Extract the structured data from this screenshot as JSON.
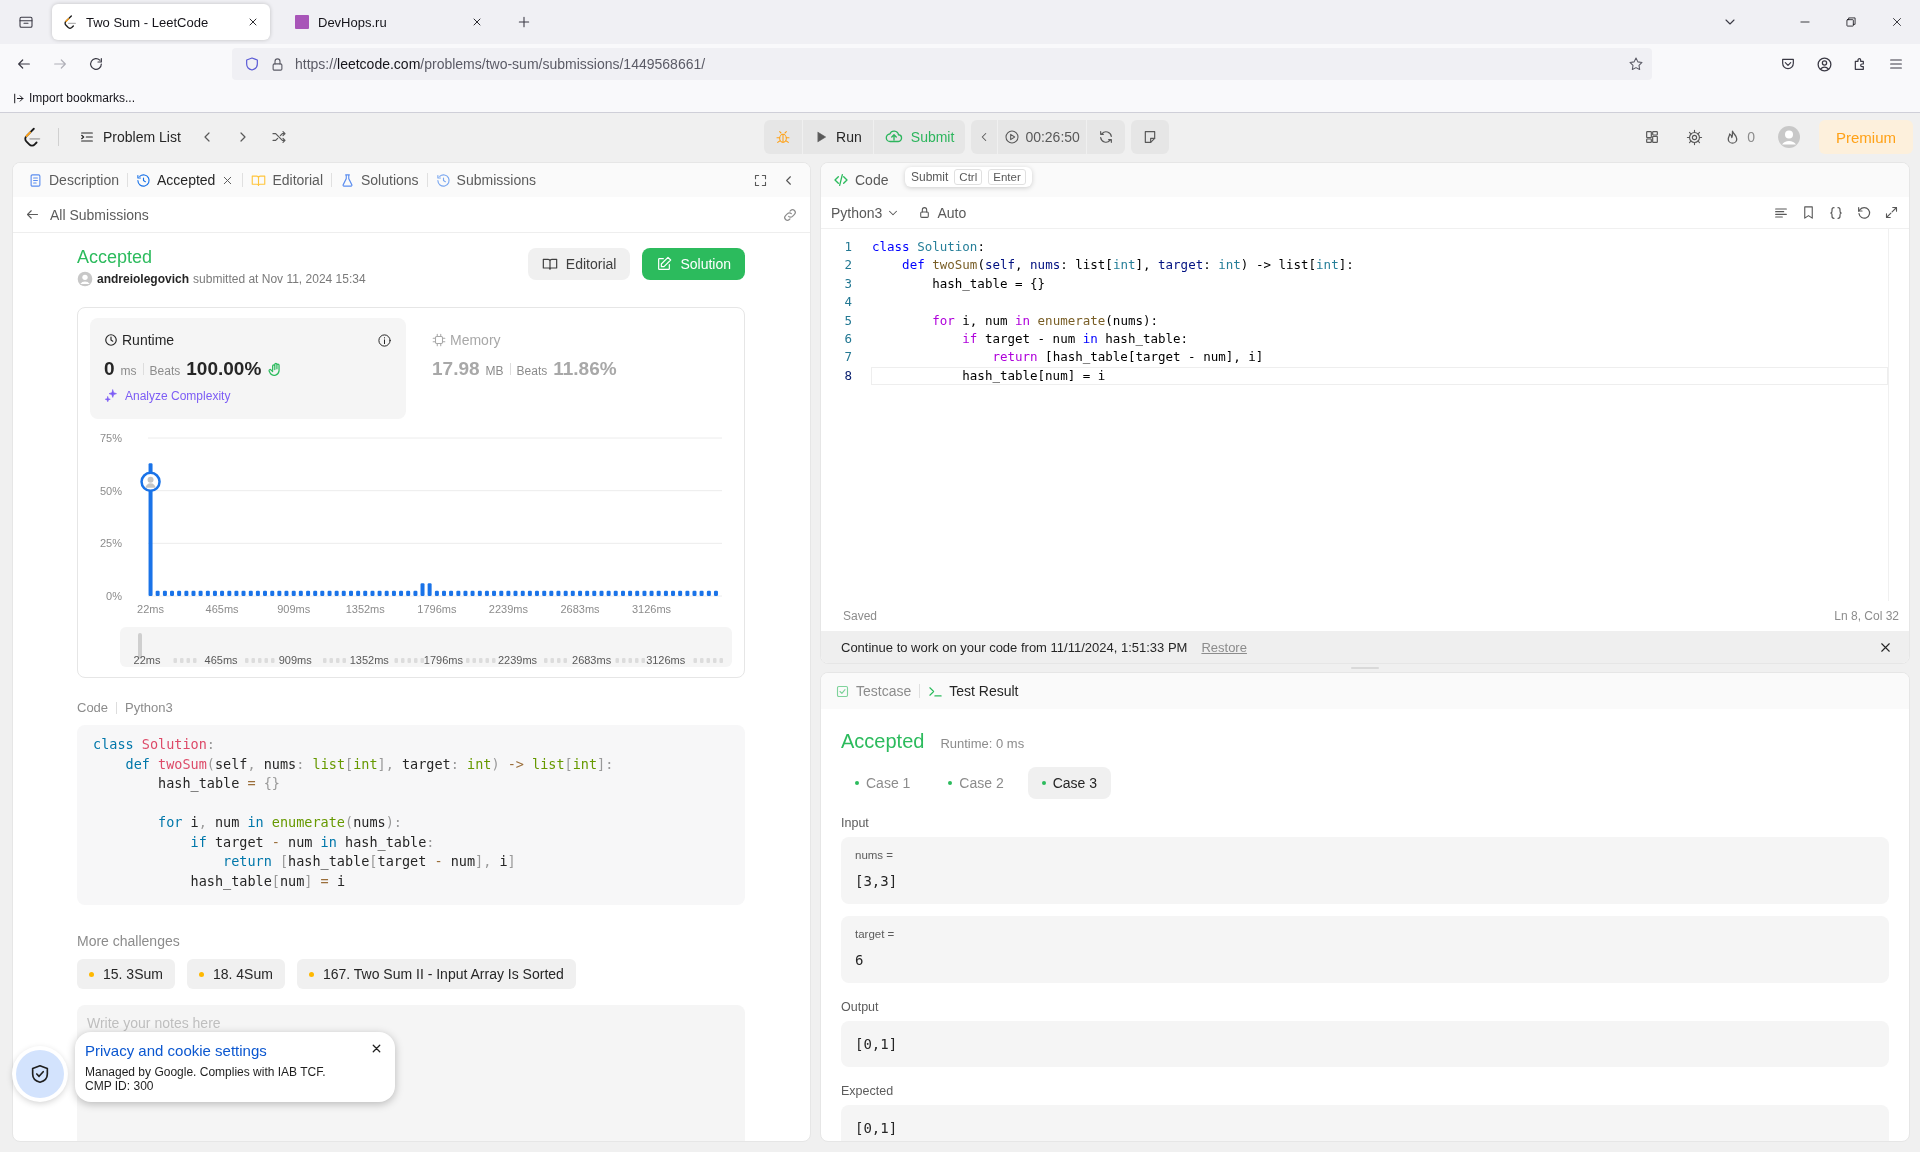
{
  "browser": {
    "tabs": [
      {
        "title": "Two Sum - LeetCode",
        "selected": true
      },
      {
        "title": "DevHops.ru",
        "selected": false
      }
    ],
    "url": {
      "prefix": "https://",
      "host": "leetcode.com",
      "path": "/problems/two-sum/submissions/1449568661/"
    },
    "bookmarks": [
      "Import bookmarks..."
    ]
  },
  "header": {
    "problem_list": "Problem List",
    "run": "Run",
    "submit": "Submit",
    "timer": "00:26:50",
    "streak": "0",
    "premium": "Premium"
  },
  "left_panel": {
    "tabs": [
      {
        "label": "Description",
        "selected": false,
        "closable": false
      },
      {
        "label": "Accepted",
        "selected": true,
        "closable": true
      },
      {
        "label": "Editorial",
        "selected": false,
        "closable": false
      },
      {
        "label": "Solutions",
        "selected": false,
        "closable": false
      },
      {
        "label": "Submissions",
        "selected": false,
        "closable": false
      }
    ],
    "back_link": "All Submissions",
    "status": "Accepted",
    "user": "andreiolegovich",
    "submitted": "submitted at Nov 11, 2024 15:34",
    "buttons": [
      {
        "label": "Editorial",
        "kind": "secondary"
      },
      {
        "label": "Solution",
        "kind": "primary"
      }
    ],
    "metrics": [
      {
        "title": "Runtime",
        "value": "0",
        "unit": "ms",
        "beats_label": "Beats",
        "beats": "100.00%",
        "selected": true,
        "link": "Analyze Complexity"
      },
      {
        "title": "Memory",
        "value": "17.98",
        "unit": "MB",
        "beats_label": "Beats",
        "beats": "11.86%",
        "selected": false
      }
    ],
    "chart_data": {
      "type": "bar",
      "xlim": [
        0,
        3550
      ],
      "ylim": [
        0,
        75
      ],
      "x": [
        22,
        66,
        111,
        155,
        199,
        244,
        288,
        332,
        377,
        421,
        465,
        510,
        554,
        598,
        643,
        687,
        731,
        776,
        820,
        864,
        909,
        953,
        998,
        1042,
        1086,
        1131,
        1175,
        1219,
        1264,
        1308,
        1352,
        1397,
        1441,
        1485,
        1530,
        1574,
        1618,
        1663,
        1707,
        1751,
        1796,
        1840,
        1884,
        1929,
        1973,
        2017,
        2062,
        2106,
        2150,
        2195,
        2239,
        2283,
        2328,
        2372,
        2416,
        2461,
        2505,
        2549,
        2594,
        2638,
        2683,
        2727,
        2771,
        2816,
        2860,
        2904,
        2949,
        2993,
        3037,
        3082,
        3126,
        3170,
        3215,
        3259,
        3303,
        3348,
        3392,
        3436,
        3481,
        3525
      ],
      "values": [
        63,
        2.5,
        2.5,
        2.5,
        2.5,
        2.5,
        2.5,
        2.5,
        2.5,
        2.5,
        2.5,
        2.5,
        2.5,
        2.5,
        2.5,
        2.5,
        2.5,
        2.5,
        2.5,
        2.5,
        2.5,
        2.5,
        2.5,
        2.5,
        2.5,
        2.5,
        2.5,
        2.5,
        2.5,
        2.5,
        2.5,
        2.5,
        2.5,
        2.5,
        2.5,
        2.5,
        2.5,
        2.5,
        6,
        6,
        2.5,
        2.5,
        2.5,
        2.5,
        2.5,
        2.5,
        2.5,
        2.5,
        2.5,
        2.5,
        2.5,
        2.5,
        2.5,
        2.5,
        2.5,
        2.5,
        2.5,
        2.5,
        2.5,
        2.5,
        2.5,
        2.5,
        2.5,
        2.5,
        2.5,
        2.5,
        2.5,
        2.5,
        2.5,
        2.5,
        2.5,
        2.5,
        2.5,
        2.5,
        2.5,
        2.5,
        2.5,
        2.5,
        2.5,
        2.5
      ],
      "xticks": [
        {
          "value": 22,
          "label": "22ms"
        },
        {
          "value": 465,
          "label": "465ms"
        },
        {
          "value": 909,
          "label": "909ms"
        },
        {
          "value": 1352,
          "label": "1352ms"
        },
        {
          "value": 1796,
          "label": "1796ms"
        },
        {
          "value": 2239,
          "label": "2239ms"
        },
        {
          "value": 2683,
          "label": "2683ms"
        },
        {
          "value": 3126,
          "label": "3126ms"
        }
      ],
      "yticks": [
        {
          "value": 0,
          "label": "0%"
        },
        {
          "value": 25,
          "label": "25%"
        },
        {
          "value": 50,
          "label": "50%"
        },
        {
          "value": 75,
          "label": "75%"
        }
      ]
    },
    "range_slider": {
      "level": 0,
      "labels": [
        "22ms",
        "465ms",
        "909ms",
        "1352ms",
        "1796ms",
        "2239ms",
        "2683ms",
        "3126ms"
      ]
    },
    "code_label": "Code",
    "language": "Python3",
    "code": [
      {
        "kind": "code",
        "tokens": [
          {
            "kind": "keyword",
            "text": "class "
          },
          {
            "kind": "type",
            "text": "Solution"
          },
          {
            "kind": "punct",
            "text": ":"
          }
        ]
      },
      {
        "kind": "code",
        "tokens": [
          {
            "kind": "keyword",
            "text": "    def "
          },
          {
            "kind": "function",
            "text": "twoSum"
          },
          {
            "kind": "punct",
            "text": "("
          },
          {
            "kind": "plain",
            "text": "self"
          },
          {
            "kind": "punct",
            "text": ", "
          },
          {
            "kind": "plain",
            "text": "nums"
          },
          {
            "kind": "punct",
            "text": ": "
          },
          {
            "kind": "builtin",
            "text": "list"
          },
          {
            "kind": "punct",
            "text": "["
          },
          {
            "kind": "builtin",
            "text": "int"
          },
          {
            "kind": "punct",
            "text": "], "
          },
          {
            "kind": "plain",
            "text": "target"
          },
          {
            "kind": "punct",
            "text": ": "
          },
          {
            "kind": "builtin",
            "text": "int"
          },
          {
            "kind": "punct",
            "text": ") "
          },
          {
            "kind": "operator",
            "text": "-> "
          },
          {
            "kind": "builtin",
            "text": "list"
          },
          {
            "kind": "punct",
            "text": "["
          },
          {
            "kind": "builtin",
            "text": "int"
          },
          {
            "kind": "punct",
            "text": "]:"
          }
        ]
      },
      {
        "kind": "code",
        "tokens": [
          {
            "kind": "plain",
            "text": "        hash_table "
          },
          {
            "kind": "operator",
            "text": "= "
          },
          {
            "kind": "punct",
            "text": "{}"
          }
        ]
      },
      {
        "kind": "blank"
      },
      {
        "kind": "code",
        "tokens": [
          {
            "kind": "keyword",
            "text": "        for"
          },
          {
            "kind": "plain",
            "text": " i"
          },
          {
            "kind": "punct",
            "text": ", "
          },
          {
            "kind": "plain",
            "text": "num "
          },
          {
            "kind": "keyword",
            "text": "in "
          },
          {
            "kind": "builtin",
            "text": "enumerate"
          },
          {
            "kind": "punct",
            "text": "("
          },
          {
            "kind": "plain",
            "text": "nums"
          },
          {
            "kind": "punct",
            "text": "):"
          }
        ]
      },
      {
        "kind": "code",
        "tokens": [
          {
            "kind": "keyword",
            "text": "            if"
          },
          {
            "kind": "plain",
            "text": " target "
          },
          {
            "kind": "operator",
            "text": "-"
          },
          {
            "kind": "plain",
            "text": " num "
          },
          {
            "kind": "keyword",
            "text": "in"
          },
          {
            "kind": "plain",
            "text": " hash_table"
          },
          {
            "kind": "punct",
            "text": ":"
          }
        ]
      },
      {
        "kind": "code",
        "tokens": [
          {
            "kind": "keyword",
            "text": "                return "
          },
          {
            "kind": "punct",
            "text": "["
          },
          {
            "kind": "plain",
            "text": "hash_table"
          },
          {
            "kind": "punct",
            "text": "["
          },
          {
            "kind": "plain",
            "text": "target "
          },
          {
            "kind": "operator",
            "text": "-"
          },
          {
            "kind": "plain",
            "text": " num"
          },
          {
            "kind": "punct",
            "text": "], "
          },
          {
            "kind": "plain",
            "text": "i"
          },
          {
            "kind": "punct",
            "text": "]"
          }
        ]
      },
      {
        "kind": "code",
        "tokens": [
          {
            "kind": "plain",
            "text": "            hash_table"
          },
          {
            "kind": "punct",
            "text": "["
          },
          {
            "kind": "plain",
            "text": "num"
          },
          {
            "kind": "punct",
            "text": "] "
          },
          {
            "kind": "operator",
            "text": "="
          },
          {
            "kind": "plain",
            "text": " i"
          }
        ]
      }
    ],
    "more_challenges": {
      "title": "More challenges",
      "items": [
        "15. 3Sum",
        "18. 4Sum",
        "167. Two Sum II - Input Array Is Sorted"
      ]
    },
    "notes": {
      "placeholder": "Write your notes here"
    }
  },
  "editor": {
    "tab": "Code",
    "tooltip": {
      "label": "Submit",
      "keys": [
        "Ctrl",
        "Enter"
      ]
    },
    "language": "Python3",
    "mode": "Auto",
    "lines": [
      {
        "kind": "code",
        "number": "1",
        "current": false,
        "tokens": [
          {
            "kind": "keyword",
            "text": "class "
          },
          {
            "kind": "type",
            "text": "Solution"
          },
          {
            "kind": "plain",
            "text": ":"
          }
        ]
      },
      {
        "kind": "code",
        "number": "2",
        "current": false,
        "tokens": [
          {
            "kind": "keyword",
            "text": "    def "
          },
          {
            "kind": "function",
            "text": "twoSum"
          },
          {
            "kind": "plain",
            "text": "("
          },
          {
            "kind": "param",
            "text": "self"
          },
          {
            "kind": "plain",
            "text": ", "
          },
          {
            "kind": "param",
            "text": "nums"
          },
          {
            "kind": "plain",
            "text": ": list["
          },
          {
            "kind": "type",
            "text": "int"
          },
          {
            "kind": "plain",
            "text": "], "
          },
          {
            "kind": "param",
            "text": "target"
          },
          {
            "kind": "plain",
            "text": ": "
          },
          {
            "kind": "type",
            "text": "int"
          },
          {
            "kind": "plain",
            "text": ") -> list["
          },
          {
            "kind": "type",
            "text": "int"
          },
          {
            "kind": "plain",
            "text": "]:"
          }
        ]
      },
      {
        "kind": "code",
        "number": "3",
        "current": false,
        "tokens": [
          {
            "kind": "plain",
            "text": "        hash_table = {}"
          }
        ]
      },
      {
        "kind": "blank",
        "number": "4",
        "current": false
      },
      {
        "kind": "code",
        "number": "5",
        "current": false,
        "tokens": [
          {
            "kind": "control",
            "text": "        for"
          },
          {
            "kind": "plain",
            "text": " i, num "
          },
          {
            "kind": "control",
            "text": "in "
          },
          {
            "kind": "function",
            "text": "enumerate"
          },
          {
            "kind": "plain",
            "text": "(nums):"
          }
        ]
      },
      {
        "kind": "code",
        "number": "6",
        "current": false,
        "tokens": [
          {
            "kind": "control",
            "text": "            if"
          },
          {
            "kind": "plain",
            "text": " target - num "
          },
          {
            "kind": "keyword",
            "text": "in"
          },
          {
            "kind": "plain",
            "text": " hash_table:"
          }
        ]
      },
      {
        "kind": "code",
        "number": "7",
        "current": false,
        "tokens": [
          {
            "kind": "control",
            "text": "                return"
          },
          {
            "kind": "plain",
            "text": " [hash_table[target - num], i]"
          }
        ]
      },
      {
        "kind": "code",
        "number": "8",
        "current": true,
        "tokens": [
          {
            "kind": "plain",
            "text": "            hash_table[num] = i"
          }
        ]
      }
    ],
    "status": "Saved",
    "cursor": "Ln 8, Col 32",
    "restore": {
      "message": "Continue to work on your code from 11/11/2024, 1:51:33 PM",
      "action": "Restore"
    }
  },
  "result": {
    "tabs": [
      {
        "label": "Testcase",
        "selected": false
      },
      {
        "label": "Test Result",
        "selected": true
      }
    ],
    "status": "Accepted",
    "runtime": "Runtime: 0 ms",
    "cases": [
      {
        "label": "Case 1",
        "selected": false
      },
      {
        "label": "Case 2",
        "selected": false
      },
      {
        "label": "Case 3",
        "selected": true
      }
    ],
    "sections": [
      {
        "label": "Input",
        "boxes": [
          {
            "name": "nums =",
            "value": "[3,3]"
          },
          {
            "name": "target =",
            "value": "6"
          }
        ]
      },
      {
        "label": "Output",
        "boxes": [
          {
            "value": "[0,1]"
          }
        ]
      },
      {
        "label": "Expected",
        "boxes": [
          {
            "value": "[0,1]"
          }
        ]
      }
    ]
  },
  "cookie": {
    "title": "Privacy and cookie settings",
    "text": "Managed by Google. Complies with IAB TCF. CMP ID: 300"
  }
}
